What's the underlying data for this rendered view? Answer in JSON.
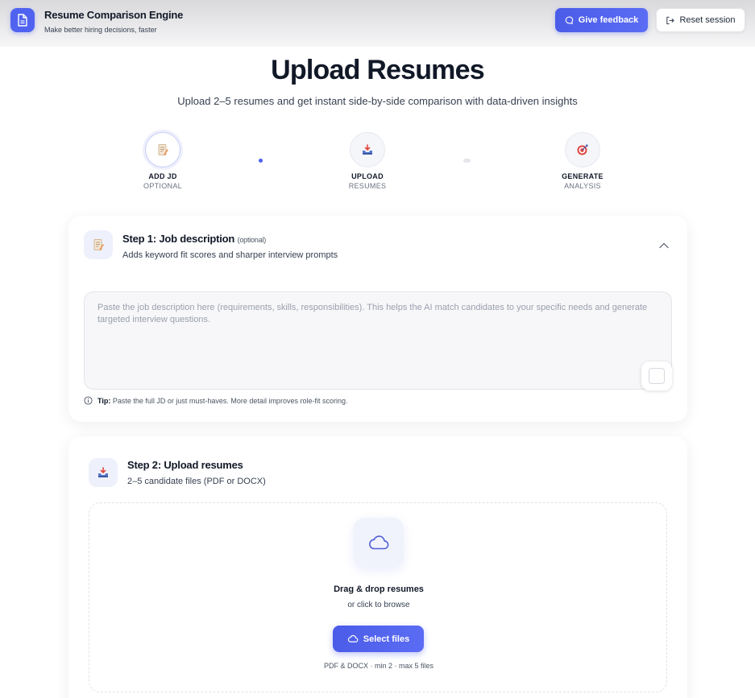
{
  "header": {
    "app_title": "Resume Comparison Engine",
    "app_subtitle": "Make better hiring decisions, faster",
    "feedback_label": "Give feedback",
    "reset_label": "Reset session"
  },
  "hero": {
    "title": "Upload Resumes",
    "subtitle": "Upload 2–5 resumes and get instant side-by-side comparison with data-driven insights"
  },
  "stepper": [
    {
      "label": "ADD JD",
      "sublabel": "OPTIONAL",
      "icon": "memo-icon",
      "active": true
    },
    {
      "label": "UPLOAD",
      "sublabel": "RESUMES",
      "icon": "inbox-tray-icon",
      "active": false
    },
    {
      "label": "GENERATE",
      "sublabel": "ANALYSIS",
      "icon": "target-icon",
      "active": false
    }
  ],
  "step1": {
    "title": "Step 1: Job description",
    "optional_tag": "(optional)",
    "description": "Adds keyword fit scores and sharper interview prompts",
    "textarea_placeholder": "Paste the job description here (requirements, skills, responsibilities). This helps the AI match candidates to your specific needs and generate targeted interview questions.",
    "textarea_value": "",
    "tip_label": "Tip:",
    "tip_text": "Paste the full JD or just must-haves. More detail improves role-fit scoring."
  },
  "step2": {
    "title": "Step 2: Upload resumes",
    "description": "2–5 candidate files (PDF or DOCX)",
    "dropzone_title": "Drag & drop resumes",
    "dropzone_subtitle": "or click to browse",
    "select_label": "Select files",
    "file_note": "PDF & DOCX · min 2 · max 5 files"
  },
  "colors": {
    "accent": "#4f63f0",
    "accent_light": "#eef0fb"
  }
}
